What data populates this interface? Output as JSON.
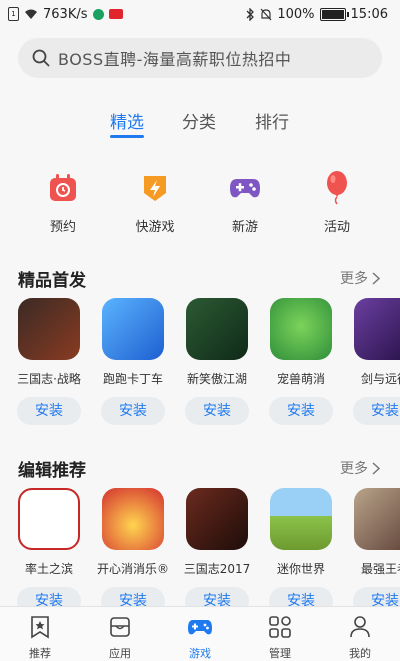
{
  "status_bar": {
    "network_speed": "763K/s",
    "battery": "100%",
    "time": "15:06"
  },
  "search": {
    "placeholder": "BOSS直聘-海量高薪职位热招中"
  },
  "tabs": [
    {
      "label": "精选",
      "active": true
    },
    {
      "label": "分类",
      "active": false
    },
    {
      "label": "排行",
      "active": false
    }
  ],
  "quick_links": [
    {
      "label": "预约",
      "icon": "calendar-icon",
      "color": "#ef5350"
    },
    {
      "label": "快游戏",
      "icon": "lightning-icon",
      "color": "#f59a23"
    },
    {
      "label": "新游",
      "icon": "gamepad-icon",
      "color": "#7e57c2"
    },
    {
      "label": "活动",
      "icon": "balloon-icon",
      "color": "#ef5350"
    }
  ],
  "sections": [
    {
      "title": "精品首发",
      "more": "更多",
      "apps": [
        {
          "name": "三国志·战略",
          "button": "安装",
          "icon_color": "#7b2e1f"
        },
        {
          "name": "跑跑卡丁车",
          "button": "安装",
          "icon_color": "#2f7fe0"
        },
        {
          "name": "新笑傲江湖",
          "button": "安装",
          "icon_color": "#1e4a2a"
        },
        {
          "name": "宠兽萌消",
          "button": "安装",
          "icon_color": "#4caf50"
        },
        {
          "name": "剑与远征",
          "button": "安装",
          "icon_color": "#4a2b7a"
        }
      ]
    },
    {
      "title": "编辑推荐",
      "more": "更多",
      "apps": [
        {
          "name": "率土之滨",
          "button": "安装",
          "icon_color": "#ffffff"
        },
        {
          "name": "开心消消乐®",
          "button": "安装",
          "icon_color": "#c62828"
        },
        {
          "name": "三国志2017",
          "button": "安装",
          "icon_color": "#4a1e1a"
        },
        {
          "name": "迷你世界",
          "button": "安装",
          "icon_color": "#8bc34a"
        },
        {
          "name": "最强王者",
          "button": "安装",
          "icon_color": "#6d4c41"
        }
      ]
    }
  ],
  "bottom_nav": [
    {
      "label": "推荐",
      "icon": "star-bookmark-icon",
      "active": false
    },
    {
      "label": "应用",
      "icon": "app-box-icon",
      "active": false
    },
    {
      "label": "游戏",
      "icon": "gamepad-icon",
      "active": true
    },
    {
      "label": "管理",
      "icon": "grid-manage-icon",
      "active": false
    },
    {
      "label": "我的",
      "icon": "person-icon",
      "active": false
    }
  ]
}
